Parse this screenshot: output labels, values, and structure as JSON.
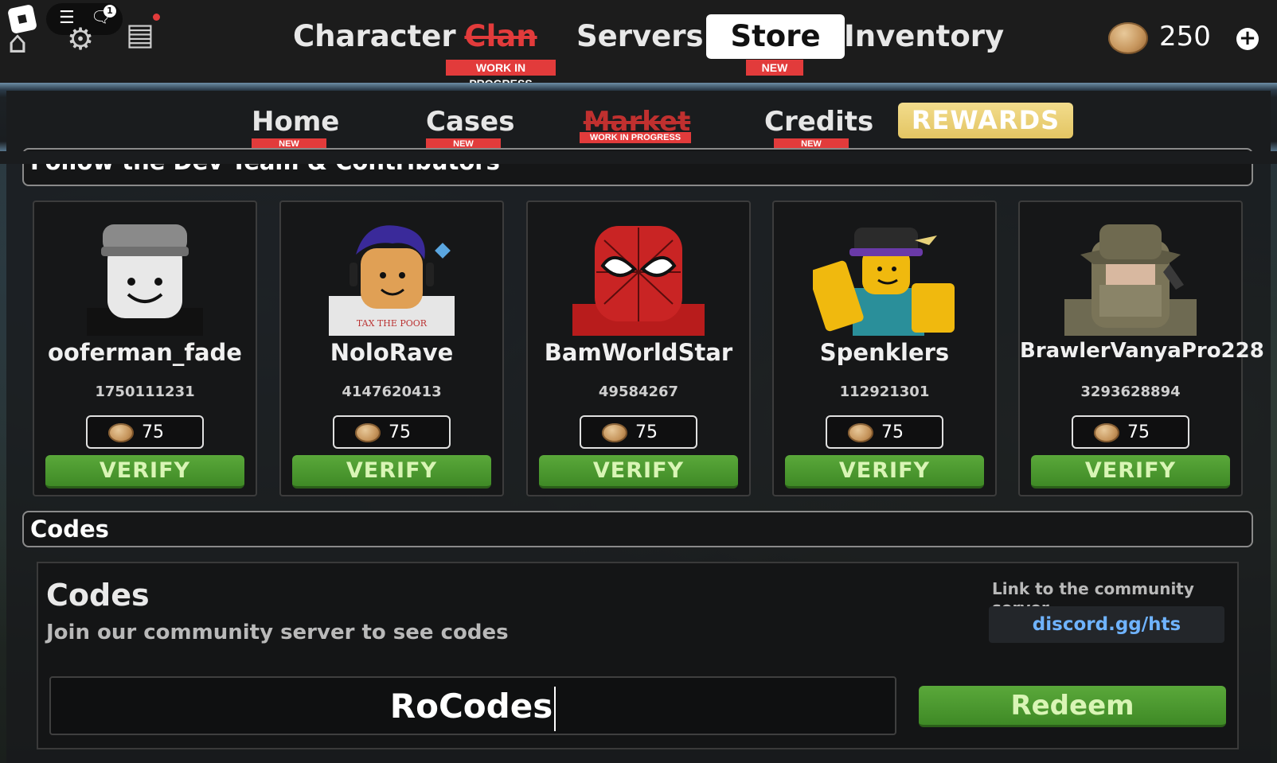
{
  "topbar": {
    "notification_count": "1",
    "tabs": [
      {
        "label": "Character"
      },
      {
        "label": "Clan",
        "tag": "WORK IN PROGRESS"
      },
      {
        "label": "Servers"
      },
      {
        "label": "Store",
        "tag": "NEW"
      },
      {
        "label": "Inventory"
      }
    ],
    "coins": "250",
    "coin_color": "#c6955c"
  },
  "subnav": {
    "tabs": [
      {
        "label": "Home",
        "tag": "NEW"
      },
      {
        "label": "Cases",
        "tag": "NEW"
      },
      {
        "label": "Market",
        "tag": "WORK IN PROGRESS"
      },
      {
        "label": "Credits",
        "tag": "NEW"
      }
    ],
    "rewards_label": "REWARDS",
    "rewards_color": "#e3c563"
  },
  "follow_section": {
    "title": "Follow the Dev Team & Contributors",
    "cards": [
      {
        "name": "ooferman_fade",
        "id": "1750111231",
        "reward": "75",
        "button": "VERIFY"
      },
      {
        "name": "NoloRave",
        "id": "4147620413",
        "reward": "75",
        "button": "VERIFY"
      },
      {
        "name": "BamWorldStar",
        "id": "49584267",
        "reward": "75",
        "button": "VERIFY"
      },
      {
        "name": "Spenklers",
        "id": "112921301",
        "reward": "75",
        "button": "VERIFY"
      },
      {
        "name": "BrawlerVanyaPro228",
        "id": "3293628894",
        "reward": "75",
        "button": "VERIFY"
      }
    ]
  },
  "codes_section": {
    "header": "Codes",
    "title": "Codes",
    "subtitle": "Join our community server to see codes",
    "link_label": "Link to the community server",
    "link": "discord.gg/hts",
    "input_value": "RoCodes",
    "redeem_label": "Redeem",
    "accent_green": "#4a9a2e",
    "tag_red": "#e23b3b"
  }
}
